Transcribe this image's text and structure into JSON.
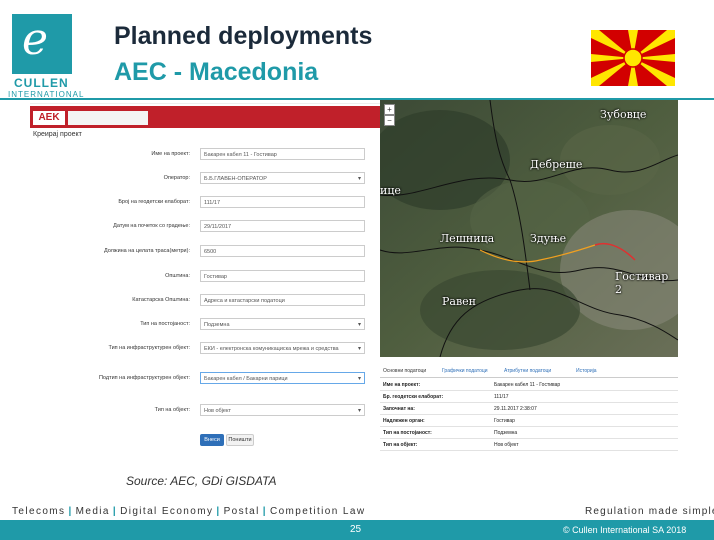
{
  "logo": {
    "brand": "CULLEN",
    "sub": "INTERNATIONAL",
    "mark": "e"
  },
  "slide": {
    "title_line1": "Planned deployments",
    "title_line2": "AEC - Macedonia"
  },
  "flag": {
    "colors": {
      "field": "#d20000",
      "sun": "#ffe600"
    }
  },
  "form": {
    "logo_text": "AEK",
    "page_title": "Креирај проект",
    "rows": [
      {
        "label": "Име на проект:",
        "value": "Бакарен кабел 11 - Гостивар",
        "type": "text"
      },
      {
        "label": "Оператор:",
        "value": "Б.Б.ГЛАВЕН-ОПЕРАТОР",
        "type": "select"
      },
      {
        "label": "Број на геодетски елаборат:",
        "value": "111/17",
        "type": "text"
      },
      {
        "label": "Датум на почеток со градење:",
        "value": "29/11/2017",
        "type": "text"
      },
      {
        "label": "Должина на целата траса(метри):",
        "value": "6500",
        "type": "text"
      },
      {
        "label": "Општина:",
        "value": "Гостивар",
        "type": "text"
      },
      {
        "label": "Катастарска Општина:",
        "value": "Адреса и катастарски податоци",
        "type": "text"
      },
      {
        "label": "Тип на постојаност:",
        "value": "Подземна",
        "type": "select"
      },
      {
        "label": "Тип на инфраструктурен објект:",
        "value": "ЕКИ - електронска комуникациска мрежа и средства",
        "type": "select"
      },
      {
        "label": "Подтип на инфраструктурен објект:",
        "value": "Бакарен кабел / Бакарни парици",
        "type": "select"
      },
      {
        "label": "Тип на објект:",
        "value": "Нов објект",
        "type": "select"
      }
    ],
    "save_label": "Внеси",
    "clear_label": "Поништи"
  },
  "map": {
    "labels": [
      "Зубовце",
      "Дебреше",
      "Лешница",
      "Здуње",
      "Равен",
      "Гостивар 2",
      "ице"
    ],
    "zoom_in": "+",
    "zoom_out": "−"
  },
  "info": {
    "tabs": [
      "Основни податоци",
      "Графички податоци",
      "Атрибутни податоци",
      "Историја"
    ],
    "rows": [
      {
        "key": "Име на проект:",
        "value": "Бакарен кабел 11 - Гостивар"
      },
      {
        "key": "Бр. геодетски елаборат:",
        "value": "111/17"
      },
      {
        "key": "Започнат на:",
        "value": "29.11.2017 2:38:07"
      },
      {
        "key": "Надлежен орган:",
        "value": "Гостивар"
      },
      {
        "key": "Тип на постојаност:",
        "value": "Подземна"
      },
      {
        "key": "Тип на објект:",
        "value": "Нов објект"
      }
    ]
  },
  "source": "Source: AEC, GDi GISDATA",
  "footer": {
    "nav": [
      "Telecoms",
      "Media",
      "Digital Economy",
      "Postal",
      "Competition Law"
    ],
    "separator": "|",
    "tagline": "Regulation made simple",
    "page_number": "25",
    "copyright": "© Cullen International SA 2018"
  },
  "colors": {
    "accent": "#1f9aa8",
    "aek_red": "#c0202a",
    "link_blue": "#2e6fb8"
  }
}
